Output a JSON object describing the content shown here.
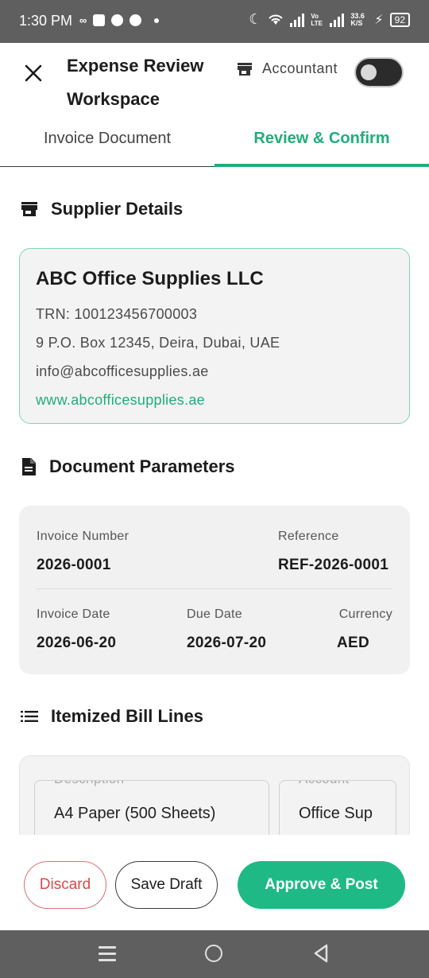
{
  "status_bar": {
    "time": "1:30 PM",
    "net_speed": "33.6 K/S",
    "volte": "Vo LTE",
    "battery": "92"
  },
  "header": {
    "title": "Expense Review Workspace",
    "role_label": "Accountant",
    "toggle_on": true
  },
  "tabs": [
    {
      "label": "Invoice Document",
      "active": false
    },
    {
      "label": "Review & Confirm",
      "active": true
    }
  ],
  "supplier": {
    "section_title": "Supplier Details",
    "name": "ABC Office Supplies LLC",
    "trn": "TRN: 100123456700003",
    "address": "9 P.O. Box 12345, Deira, Dubai, UAE",
    "email": "info@abcofficesupplies.ae",
    "website": "www.abcofficesupplies.ae"
  },
  "document": {
    "section_title": "Document Parameters",
    "invoice_number_label": "Invoice Number",
    "invoice_number": "2026-0001",
    "reference_label": "Reference",
    "reference": "REF-2026-0001",
    "invoice_date_label": "Invoice Date",
    "invoice_date": "2026-06-20",
    "due_date_label": "Due Date",
    "due_date": "2026-07-20",
    "currency_label": "Currency",
    "currency": "AED"
  },
  "bill_lines": {
    "section_title": "Itemized Bill Lines",
    "description_label": "Description",
    "description_value": "A4 Paper (500 Sheets)",
    "account_label": "Account",
    "account_value": "Office Sup"
  },
  "actions": {
    "discard": "Discard",
    "save_draft": "Save Draft",
    "approve": "Approve & Post"
  },
  "colors": {
    "accent": "#1fae7a",
    "danger": "#d94a4a",
    "status_bar": "#5f5f5f"
  }
}
